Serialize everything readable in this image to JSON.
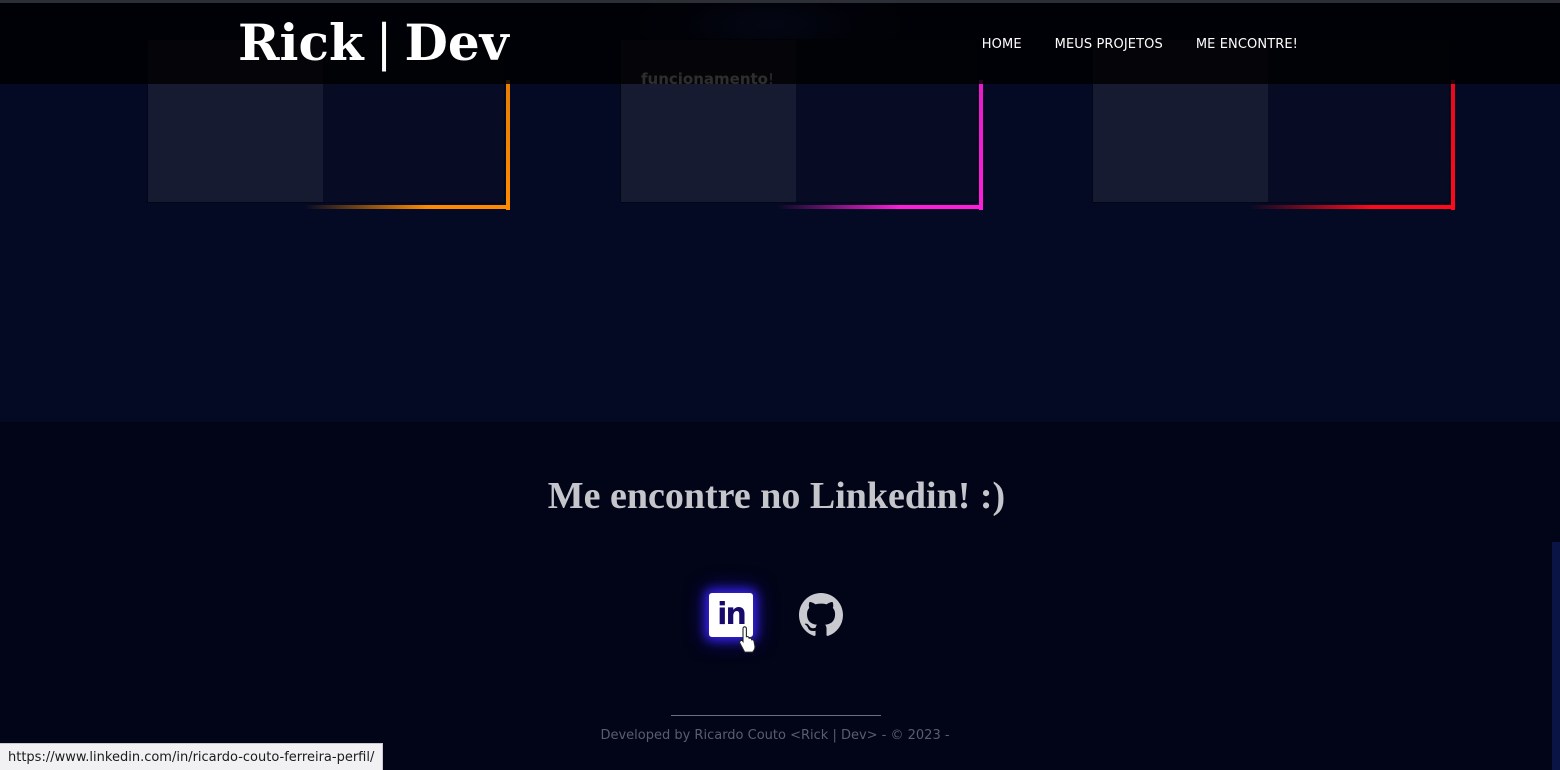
{
  "header": {
    "logo_left": "Rick",
    "logo_sep": "|",
    "logo_right": "Dev",
    "nav": {
      "home": "HOME",
      "projects": "MEUS PROJETOS",
      "contact": "ME ENCONTRE!"
    }
  },
  "projects": {
    "card2_text": "funcionamento",
    "card2_punct": "!",
    "accent_colors": [
      "#ff8a00",
      "#ff1ed8",
      "#ff0a1a"
    ]
  },
  "footer": {
    "title": "Me encontre no Linkedin! :)",
    "linkedin_label": "in",
    "credits": "Developed by Ricardo Couto <Rick | Dev> - © 2023 -"
  },
  "status_bar": {
    "url": "https://www.linkedin.com/in/ricardo-couto-ferreira-perfil/"
  }
}
